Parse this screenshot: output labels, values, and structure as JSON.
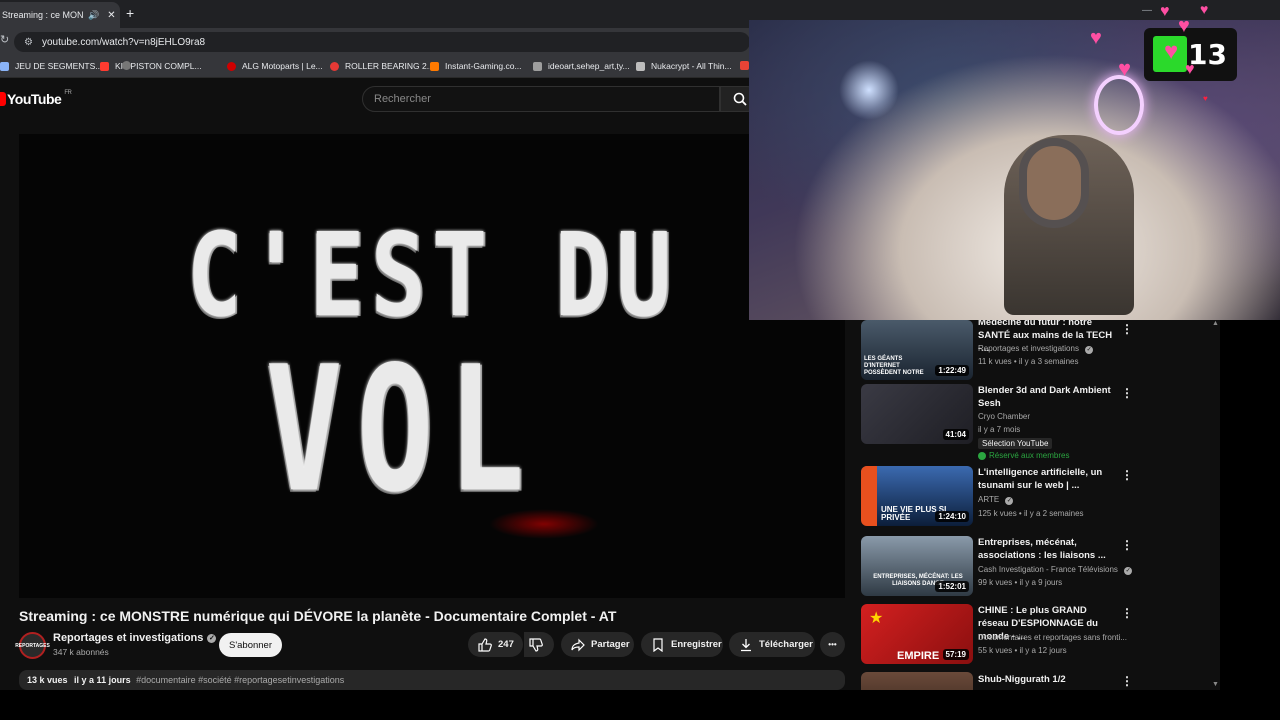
{
  "browser": {
    "tab_title": "Streaming : ce MONSTR",
    "tab_audio_icon": "speaker-icon",
    "new_tab": "+",
    "url": "youtube.com/watch?v=n8jEHLO9ra8",
    "bookmarks": [
      {
        "label": "JEU DE SEGMENTS...",
        "color": "#8ab4f8"
      },
      {
        "label": "KIT PISTON COMPL...",
        "color": "#ff3b30"
      },
      {
        "label": "ALG Motoparts | Le...",
        "color": "#d00000"
      },
      {
        "label": "ROLLER BEARING 2...",
        "color": "#e53935"
      },
      {
        "label": "Instant-Gaming.co...",
        "color": "#ff7a00"
      },
      {
        "label": "ideoart,sehep_art,ty...",
        "color": "#9e9e9e"
      },
      {
        "label": "Nukacrypt - All Thin...",
        "color": "#bdbdbd"
      }
    ]
  },
  "youtube": {
    "logo": "YouTube",
    "region": "FR",
    "search_placeholder": "Rechercher"
  },
  "player": {
    "line1": "C'EST DU",
    "line2": "VOL"
  },
  "video": {
    "title": "Streaming : ce MONSTRE numérique qui DÉVORE la planète - Documentaire Complet - AT",
    "channel": "Reportages et investigations",
    "avatar_text": "REPORTAGES",
    "subscribers": "347 k abonnés",
    "subscribe_label": "S'abonner",
    "likes": "247",
    "share_label": "Partager",
    "save_label": "Enregistrer",
    "download_label": "Télécharger",
    "more": "•••",
    "views": "13 k vues",
    "date": "il y a 11 jours",
    "tags": "#documentaire #société #reportagesetinvestigations"
  },
  "recommendations": [
    {
      "title": "Médecine du futur : notre SANTÉ aux mains de la TECH -...",
      "channel": "Reportages et investigations",
      "verified": true,
      "stats": "11 k vues • il y a 3 semaines",
      "duration": "1:22:49",
      "thumb_text": "LES GÉANTS D'INTERNET POSSÈDENT NOTRE",
      "thumb_color": "#1a2430"
    },
    {
      "title": "Blender 3d and Dark Ambient Sesh",
      "channel": "Cryo Chamber",
      "verified": false,
      "stats": "il y a 7 mois",
      "duration": "41:04",
      "badge": "Sélection YouTube",
      "member": "Réservé aux membres",
      "thumb_text": "",
      "thumb_color": "#2a2a30"
    },
    {
      "title": "L'intelligence artificielle, un tsunami sur le web | ...",
      "channel": "ARTE",
      "verified": true,
      "stats": "125 k vues • il y a 2 semaines",
      "duration": "1:24:10",
      "thumb_text": "UNE VIE PLUS SI PRIVÉE",
      "thumb_color": "#1b3a6a"
    },
    {
      "title": "Entreprises, mécénat, associations : les liaisons ...",
      "channel": "Cash Investigation - France Télévisions",
      "verified": true,
      "stats": "99 k vues • il y a 9 jours",
      "duration": "1:52:01",
      "thumb_text": "ENTREPRISES, MÉCÉNAT: LES LIAISONS DANGE",
      "thumb_color": "#2f3a44"
    },
    {
      "title": "CHINE : Le plus GRAND réseau D'ESPIONNAGE du monde - ...",
      "channel": "Documentaires et reportages sans fronti...",
      "verified": false,
      "stats": "55 k vues • il y a 12 jours",
      "duration": "57:19",
      "thumb_text": "EMPIRE",
      "thumb_color": "#b51a1a"
    },
    {
      "title": "Shub-Niggurath 1/2",
      "channel": "",
      "verified": false,
      "stats": "",
      "duration": "",
      "thumb_text": "",
      "thumb_color": "#3a2a22"
    }
  ],
  "overlay": {
    "viewer_count": "13"
  },
  "colors": {
    "accent": "#ff0000",
    "background": "#0f0f0f",
    "member_green": "#2ba640",
    "heart_pink": "#ff4fa3"
  }
}
